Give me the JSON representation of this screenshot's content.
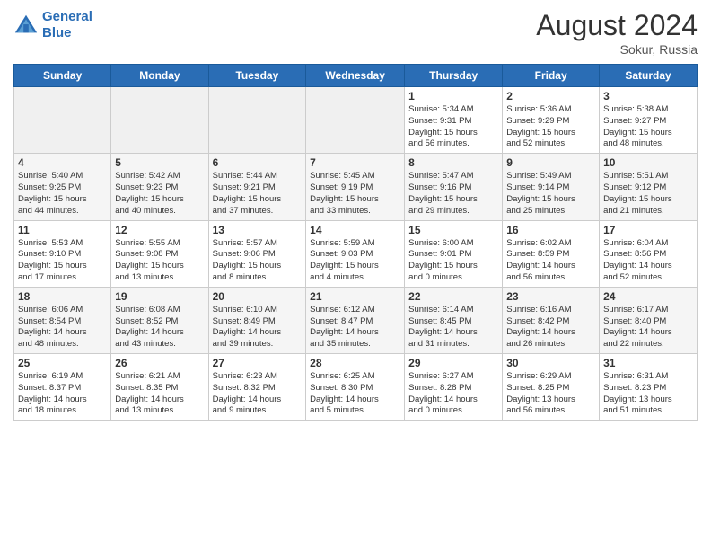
{
  "header": {
    "logo_line1": "General",
    "logo_line2": "Blue",
    "month_year": "August 2024",
    "location": "Sokur, Russia"
  },
  "weekdays": [
    "Sunday",
    "Monday",
    "Tuesday",
    "Wednesday",
    "Thursday",
    "Friday",
    "Saturday"
  ],
  "rows": [
    [
      {
        "day": "",
        "info": ""
      },
      {
        "day": "",
        "info": ""
      },
      {
        "day": "",
        "info": ""
      },
      {
        "day": "",
        "info": ""
      },
      {
        "day": "1",
        "info": "Sunrise: 5:34 AM\nSunset: 9:31 PM\nDaylight: 15 hours\nand 56 minutes."
      },
      {
        "day": "2",
        "info": "Sunrise: 5:36 AM\nSunset: 9:29 PM\nDaylight: 15 hours\nand 52 minutes."
      },
      {
        "day": "3",
        "info": "Sunrise: 5:38 AM\nSunset: 9:27 PM\nDaylight: 15 hours\nand 48 minutes."
      }
    ],
    [
      {
        "day": "4",
        "info": "Sunrise: 5:40 AM\nSunset: 9:25 PM\nDaylight: 15 hours\nand 44 minutes."
      },
      {
        "day": "5",
        "info": "Sunrise: 5:42 AM\nSunset: 9:23 PM\nDaylight: 15 hours\nand 40 minutes."
      },
      {
        "day": "6",
        "info": "Sunrise: 5:44 AM\nSunset: 9:21 PM\nDaylight: 15 hours\nand 37 minutes."
      },
      {
        "day": "7",
        "info": "Sunrise: 5:45 AM\nSunset: 9:19 PM\nDaylight: 15 hours\nand 33 minutes."
      },
      {
        "day": "8",
        "info": "Sunrise: 5:47 AM\nSunset: 9:16 PM\nDaylight: 15 hours\nand 29 minutes."
      },
      {
        "day": "9",
        "info": "Sunrise: 5:49 AM\nSunset: 9:14 PM\nDaylight: 15 hours\nand 25 minutes."
      },
      {
        "day": "10",
        "info": "Sunrise: 5:51 AM\nSunset: 9:12 PM\nDaylight: 15 hours\nand 21 minutes."
      }
    ],
    [
      {
        "day": "11",
        "info": "Sunrise: 5:53 AM\nSunset: 9:10 PM\nDaylight: 15 hours\nand 17 minutes."
      },
      {
        "day": "12",
        "info": "Sunrise: 5:55 AM\nSunset: 9:08 PM\nDaylight: 15 hours\nand 13 minutes."
      },
      {
        "day": "13",
        "info": "Sunrise: 5:57 AM\nSunset: 9:06 PM\nDaylight: 15 hours\nand 8 minutes."
      },
      {
        "day": "14",
        "info": "Sunrise: 5:59 AM\nSunset: 9:03 PM\nDaylight: 15 hours\nand 4 minutes."
      },
      {
        "day": "15",
        "info": "Sunrise: 6:00 AM\nSunset: 9:01 PM\nDaylight: 15 hours\nand 0 minutes."
      },
      {
        "day": "16",
        "info": "Sunrise: 6:02 AM\nSunset: 8:59 PM\nDaylight: 14 hours\nand 56 minutes."
      },
      {
        "day": "17",
        "info": "Sunrise: 6:04 AM\nSunset: 8:56 PM\nDaylight: 14 hours\nand 52 minutes."
      }
    ],
    [
      {
        "day": "18",
        "info": "Sunrise: 6:06 AM\nSunset: 8:54 PM\nDaylight: 14 hours\nand 48 minutes."
      },
      {
        "day": "19",
        "info": "Sunrise: 6:08 AM\nSunset: 8:52 PM\nDaylight: 14 hours\nand 43 minutes."
      },
      {
        "day": "20",
        "info": "Sunrise: 6:10 AM\nSunset: 8:49 PM\nDaylight: 14 hours\nand 39 minutes."
      },
      {
        "day": "21",
        "info": "Sunrise: 6:12 AM\nSunset: 8:47 PM\nDaylight: 14 hours\nand 35 minutes."
      },
      {
        "day": "22",
        "info": "Sunrise: 6:14 AM\nSunset: 8:45 PM\nDaylight: 14 hours\nand 31 minutes."
      },
      {
        "day": "23",
        "info": "Sunrise: 6:16 AM\nSunset: 8:42 PM\nDaylight: 14 hours\nand 26 minutes."
      },
      {
        "day": "24",
        "info": "Sunrise: 6:17 AM\nSunset: 8:40 PM\nDaylight: 14 hours\nand 22 minutes."
      }
    ],
    [
      {
        "day": "25",
        "info": "Sunrise: 6:19 AM\nSunset: 8:37 PM\nDaylight: 14 hours\nand 18 minutes."
      },
      {
        "day": "26",
        "info": "Sunrise: 6:21 AM\nSunset: 8:35 PM\nDaylight: 14 hours\nand 13 minutes."
      },
      {
        "day": "27",
        "info": "Sunrise: 6:23 AM\nSunset: 8:32 PM\nDaylight: 14 hours\nand 9 minutes."
      },
      {
        "day": "28",
        "info": "Sunrise: 6:25 AM\nSunset: 8:30 PM\nDaylight: 14 hours\nand 5 minutes."
      },
      {
        "day": "29",
        "info": "Sunrise: 6:27 AM\nSunset: 8:28 PM\nDaylight: 14 hours\nand 0 minutes."
      },
      {
        "day": "30",
        "info": "Sunrise: 6:29 AM\nSunset: 8:25 PM\nDaylight: 13 hours\nand 56 minutes."
      },
      {
        "day": "31",
        "info": "Sunrise: 6:31 AM\nSunset: 8:23 PM\nDaylight: 13 hours\nand 51 minutes."
      }
    ]
  ]
}
